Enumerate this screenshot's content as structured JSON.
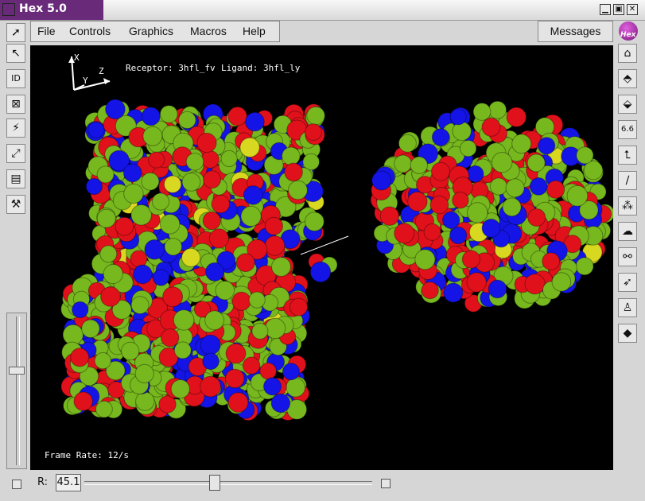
{
  "window": {
    "title": "Hex 5.0"
  },
  "menu": [
    "File",
    "Controls",
    "Graphics",
    "Macros",
    "Help"
  ],
  "messages_button": "Messages",
  "logo_text": "Hex",
  "left_tools": [
    {
      "name": "select-arrow-icon",
      "glyph": "➚"
    },
    {
      "name": "pointer-icon",
      "glyph": "↖"
    },
    {
      "name": "id-icon",
      "glyph": "ID"
    },
    {
      "name": "cross-box-icon",
      "glyph": "⊠"
    },
    {
      "name": "lightning-icon",
      "glyph": "⚡"
    },
    {
      "name": "measure-icon",
      "glyph": "⤢"
    },
    {
      "name": "cylinder-icon",
      "glyph": "▤"
    },
    {
      "name": "hammer-icon",
      "glyph": "⚒"
    }
  ],
  "right_tools": [
    {
      "name": "home-icon",
      "glyph": "⌂"
    },
    {
      "name": "molecule-up-icon",
      "glyph": "⬘"
    },
    {
      "name": "molecule-down-icon",
      "glyph": "⬙"
    },
    {
      "name": "number-66-icon",
      "glyph": "6.6"
    },
    {
      "name": "axis-icon",
      "glyph": "⮤"
    },
    {
      "name": "line-icon",
      "glyph": "∕"
    },
    {
      "name": "spheres-icon",
      "glyph": "⁂"
    },
    {
      "name": "surface-icon",
      "glyph": "☁"
    },
    {
      "name": "dock-icon",
      "glyph": "⚯"
    },
    {
      "name": "arrow-dock-icon",
      "glyph": "➶"
    },
    {
      "name": "person-icon",
      "glyph": "♙"
    },
    {
      "name": "diamond-icon",
      "glyph": "◆"
    }
  ],
  "viewport": {
    "axis_labels": {
      "x": "X",
      "y": "Y",
      "z": "Z"
    },
    "receptor_label": "Receptor: 3hfl_fv",
    "ligand_label": "Ligand: 3hfl_ly",
    "frame_rate": "Frame Rate: 12/s",
    "atom_colors": [
      "#77b81e",
      "#e0111b",
      "#1414e6",
      "#d8d820"
    ]
  },
  "bottom": {
    "r_label": "R:",
    "r_value": "45.1",
    "r_slider_fraction": 0.45
  }
}
